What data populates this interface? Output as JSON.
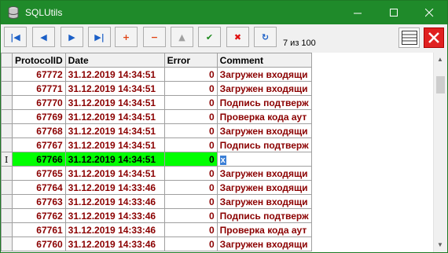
{
  "window": {
    "title": "SQLUtils"
  },
  "toolbar": {
    "counter": "7 из 100",
    "buttons": [
      {
        "name": "first-record-button",
        "glyph": "|◀",
        "color": "#1b5fc7"
      },
      {
        "name": "prior-record-button",
        "glyph": "◀",
        "color": "#1b5fc7"
      },
      {
        "name": "next-record-button",
        "glyph": "▶",
        "color": "#1b5fc7"
      },
      {
        "name": "last-record-button",
        "glyph": "▶|",
        "color": "#1b5fc7"
      },
      {
        "name": "insert-record-button",
        "glyph": "+",
        "color": "#e04010"
      },
      {
        "name": "delete-record-button",
        "glyph": "−",
        "color": "#e04010"
      },
      {
        "name": "edit-record-button",
        "glyph": "▲",
        "color": "#a0a0a0"
      },
      {
        "name": "post-record-button",
        "glyph": "✔",
        "color": "#1d8a1d"
      },
      {
        "name": "cancel-edit-button",
        "glyph": "✖",
        "color": "#e01010"
      },
      {
        "name": "refresh-button",
        "glyph": "↻",
        "color": "#1b5fc7"
      }
    ]
  },
  "grid": {
    "columns": [
      "ProtocolID",
      "Date",
      "Error",
      "Comment"
    ],
    "rows": [
      {
        "id": "67772",
        "date": "31.12.2019 14:34:51",
        "error": "0",
        "comment": "Загружен входящи"
      },
      {
        "id": "67771",
        "date": "31.12.2019 14:34:51",
        "error": "0",
        "comment": "Загружен входящи"
      },
      {
        "id": "67770",
        "date": "31.12.2019 14:34:51",
        "error": "0",
        "comment": "Подпись подтверж"
      },
      {
        "id": "67769",
        "date": "31.12.2019 14:34:51",
        "error": "0",
        "comment": "Проверка кода аут"
      },
      {
        "id": "67768",
        "date": "31.12.2019 14:34:51",
        "error": "0",
        "comment": "Загружен входящи"
      },
      {
        "id": "67767",
        "date": "31.12.2019 14:34:51",
        "error": "0",
        "comment": "Подпись подтверж"
      },
      {
        "id": "67766",
        "date": "31.12.2019 14:34:51",
        "error": "0",
        "comment": "х",
        "selected": true
      },
      {
        "id": "67765",
        "date": "31.12.2019 14:34:51",
        "error": "0",
        "comment": "Загружен входящи"
      },
      {
        "id": "67764",
        "date": "31.12.2019 14:33:46",
        "error": "0",
        "comment": "Загружен входящи"
      },
      {
        "id": "67763",
        "date": "31.12.2019 14:33:46",
        "error": "0",
        "comment": "Загружен входящи"
      },
      {
        "id": "67762",
        "date": "31.12.2019 14:33:46",
        "error": "0",
        "comment": "Подпись подтверж"
      },
      {
        "id": "67761",
        "date": "31.12.2019 14:33:46",
        "error": "0",
        "comment": "Проверка кода аут"
      },
      {
        "id": "67760",
        "date": "31.12.2019 14:33:46",
        "error": "0",
        "comment": "Загружен входящи"
      }
    ]
  },
  "colors": {
    "titlebar": "#1f8a2a",
    "selected_row": "#00ff00",
    "cell_text": "#8b0000"
  }
}
